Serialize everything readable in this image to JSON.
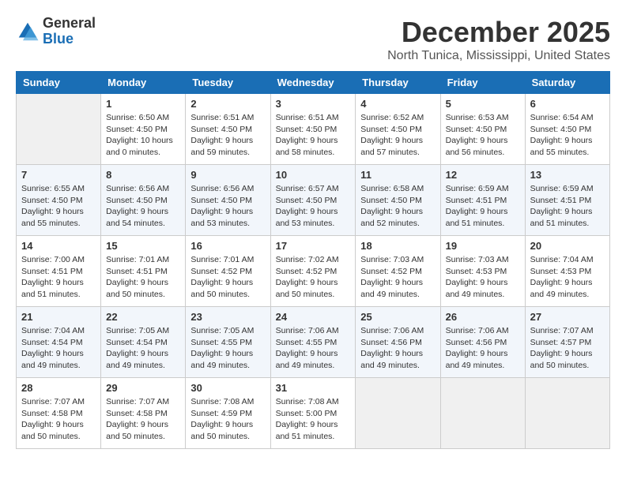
{
  "logo": {
    "general": "General",
    "blue": "Blue"
  },
  "header": {
    "title": "December 2025",
    "subtitle": "North Tunica, Mississippi, United States"
  },
  "days_of_week": [
    "Sunday",
    "Monday",
    "Tuesday",
    "Wednesday",
    "Thursday",
    "Friday",
    "Saturday"
  ],
  "weeks": [
    [
      {
        "day": "",
        "empty": true
      },
      {
        "day": "1",
        "sunrise": "Sunrise: 6:50 AM",
        "sunset": "Sunset: 4:50 PM",
        "daylight": "Daylight: 10 hours and 0 minutes."
      },
      {
        "day": "2",
        "sunrise": "Sunrise: 6:51 AM",
        "sunset": "Sunset: 4:50 PM",
        "daylight": "Daylight: 9 hours and 59 minutes."
      },
      {
        "day": "3",
        "sunrise": "Sunrise: 6:51 AM",
        "sunset": "Sunset: 4:50 PM",
        "daylight": "Daylight: 9 hours and 58 minutes."
      },
      {
        "day": "4",
        "sunrise": "Sunrise: 6:52 AM",
        "sunset": "Sunset: 4:50 PM",
        "daylight": "Daylight: 9 hours and 57 minutes."
      },
      {
        "day": "5",
        "sunrise": "Sunrise: 6:53 AM",
        "sunset": "Sunset: 4:50 PM",
        "daylight": "Daylight: 9 hours and 56 minutes."
      },
      {
        "day": "6",
        "sunrise": "Sunrise: 6:54 AM",
        "sunset": "Sunset: 4:50 PM",
        "daylight": "Daylight: 9 hours and 55 minutes."
      }
    ],
    [
      {
        "day": "7",
        "sunrise": "Sunrise: 6:55 AM",
        "sunset": "Sunset: 4:50 PM",
        "daylight": "Daylight: 9 hours and 55 minutes."
      },
      {
        "day": "8",
        "sunrise": "Sunrise: 6:56 AM",
        "sunset": "Sunset: 4:50 PM",
        "daylight": "Daylight: 9 hours and 54 minutes."
      },
      {
        "day": "9",
        "sunrise": "Sunrise: 6:56 AM",
        "sunset": "Sunset: 4:50 PM",
        "daylight": "Daylight: 9 hours and 53 minutes."
      },
      {
        "day": "10",
        "sunrise": "Sunrise: 6:57 AM",
        "sunset": "Sunset: 4:50 PM",
        "daylight": "Daylight: 9 hours and 53 minutes."
      },
      {
        "day": "11",
        "sunrise": "Sunrise: 6:58 AM",
        "sunset": "Sunset: 4:50 PM",
        "daylight": "Daylight: 9 hours and 52 minutes."
      },
      {
        "day": "12",
        "sunrise": "Sunrise: 6:59 AM",
        "sunset": "Sunset: 4:51 PM",
        "daylight": "Daylight: 9 hours and 51 minutes."
      },
      {
        "day": "13",
        "sunrise": "Sunrise: 6:59 AM",
        "sunset": "Sunset: 4:51 PM",
        "daylight": "Daylight: 9 hours and 51 minutes."
      }
    ],
    [
      {
        "day": "14",
        "sunrise": "Sunrise: 7:00 AM",
        "sunset": "Sunset: 4:51 PM",
        "daylight": "Daylight: 9 hours and 51 minutes."
      },
      {
        "day": "15",
        "sunrise": "Sunrise: 7:01 AM",
        "sunset": "Sunset: 4:51 PM",
        "daylight": "Daylight: 9 hours and 50 minutes."
      },
      {
        "day": "16",
        "sunrise": "Sunrise: 7:01 AM",
        "sunset": "Sunset: 4:52 PM",
        "daylight": "Daylight: 9 hours and 50 minutes."
      },
      {
        "day": "17",
        "sunrise": "Sunrise: 7:02 AM",
        "sunset": "Sunset: 4:52 PM",
        "daylight": "Daylight: 9 hours and 50 minutes."
      },
      {
        "day": "18",
        "sunrise": "Sunrise: 7:03 AM",
        "sunset": "Sunset: 4:52 PM",
        "daylight": "Daylight: 9 hours and 49 minutes."
      },
      {
        "day": "19",
        "sunrise": "Sunrise: 7:03 AM",
        "sunset": "Sunset: 4:53 PM",
        "daylight": "Daylight: 9 hours and 49 minutes."
      },
      {
        "day": "20",
        "sunrise": "Sunrise: 7:04 AM",
        "sunset": "Sunset: 4:53 PM",
        "daylight": "Daylight: 9 hours and 49 minutes."
      }
    ],
    [
      {
        "day": "21",
        "sunrise": "Sunrise: 7:04 AM",
        "sunset": "Sunset: 4:54 PM",
        "daylight": "Daylight: 9 hours and 49 minutes."
      },
      {
        "day": "22",
        "sunrise": "Sunrise: 7:05 AM",
        "sunset": "Sunset: 4:54 PM",
        "daylight": "Daylight: 9 hours and 49 minutes."
      },
      {
        "day": "23",
        "sunrise": "Sunrise: 7:05 AM",
        "sunset": "Sunset: 4:55 PM",
        "daylight": "Daylight: 9 hours and 49 minutes."
      },
      {
        "day": "24",
        "sunrise": "Sunrise: 7:06 AM",
        "sunset": "Sunset: 4:55 PM",
        "daylight": "Daylight: 9 hours and 49 minutes."
      },
      {
        "day": "25",
        "sunrise": "Sunrise: 7:06 AM",
        "sunset": "Sunset: 4:56 PM",
        "daylight": "Daylight: 9 hours and 49 minutes."
      },
      {
        "day": "26",
        "sunrise": "Sunrise: 7:06 AM",
        "sunset": "Sunset: 4:56 PM",
        "daylight": "Daylight: 9 hours and 49 minutes."
      },
      {
        "day": "27",
        "sunrise": "Sunrise: 7:07 AM",
        "sunset": "Sunset: 4:57 PM",
        "daylight": "Daylight: 9 hours and 50 minutes."
      }
    ],
    [
      {
        "day": "28",
        "sunrise": "Sunrise: 7:07 AM",
        "sunset": "Sunset: 4:58 PM",
        "daylight": "Daylight: 9 hours and 50 minutes."
      },
      {
        "day": "29",
        "sunrise": "Sunrise: 7:07 AM",
        "sunset": "Sunset: 4:58 PM",
        "daylight": "Daylight: 9 hours and 50 minutes."
      },
      {
        "day": "30",
        "sunrise": "Sunrise: 7:08 AM",
        "sunset": "Sunset: 4:59 PM",
        "daylight": "Daylight: 9 hours and 50 minutes."
      },
      {
        "day": "31",
        "sunrise": "Sunrise: 7:08 AM",
        "sunset": "Sunset: 5:00 PM",
        "daylight": "Daylight: 9 hours and 51 minutes."
      },
      {
        "day": "",
        "empty": true
      },
      {
        "day": "",
        "empty": true
      },
      {
        "day": "",
        "empty": true
      }
    ]
  ]
}
